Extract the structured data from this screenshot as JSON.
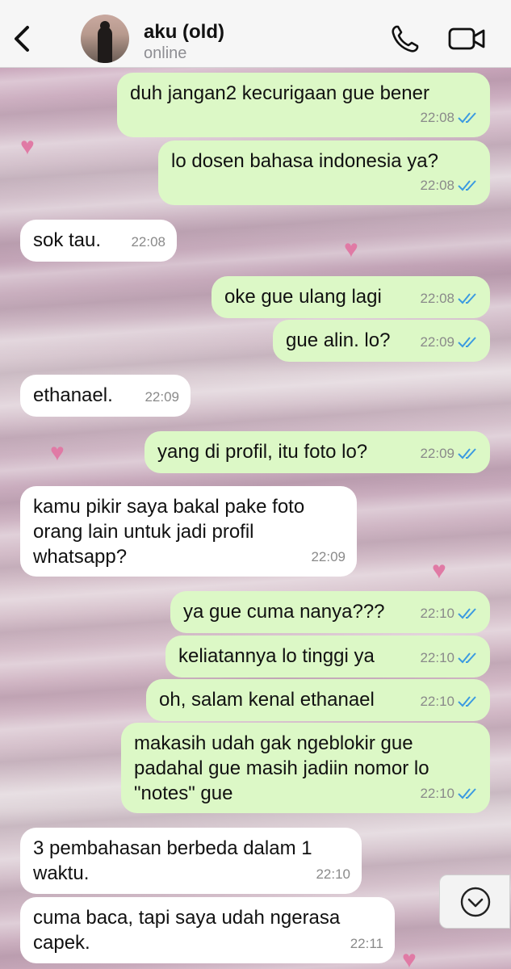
{
  "header": {
    "contact_name": "aku (old)",
    "status": "online"
  },
  "messages": [
    {
      "dir": "out",
      "text": "duh jangan2 kecurigaan gue bener",
      "time": "22:08"
    },
    {
      "dir": "out",
      "text": "lo dosen bahasa indonesia ya?",
      "time": "22:08"
    },
    {
      "dir": "in",
      "text": "sok tau.",
      "time": "22:08"
    },
    {
      "dir": "out",
      "text": "oke gue ulang lagi",
      "time": "22:08"
    },
    {
      "dir": "out",
      "text": "gue alin. lo?",
      "time": "22:09"
    },
    {
      "dir": "in",
      "text": "ethanael.",
      "time": "22:09"
    },
    {
      "dir": "out",
      "text": "yang di profil, itu foto lo?",
      "time": "22:09"
    },
    {
      "dir": "in",
      "text": "kamu pikir saya bakal pake foto\norang lain untuk jadi profil\nwhatsapp?",
      "time": "22:09"
    },
    {
      "dir": "out",
      "text": "ya gue cuma nanya???",
      "time": "22:10"
    },
    {
      "dir": "out",
      "text": "keliatannya lo tinggi ya",
      "time": "22:10"
    },
    {
      "dir": "out",
      "text": "oh, salam kenal ethanael",
      "time": "22:10"
    },
    {
      "dir": "out",
      "text": "makasih udah gak ngeblokir gue\npadahal gue masih jadiin nomor lo\n\"notes\" gue",
      "time": "22:10"
    },
    {
      "dir": "in",
      "text": "3 pembahasan berbeda dalam 1\nwaktu.",
      "time": "22:10"
    },
    {
      "dir": "in",
      "text": "cuma baca, tapi saya udah ngerasa\ncapek.",
      "time": "22:11"
    }
  ],
  "colors": {
    "outgoing_bubble": "#dcf8c6",
    "incoming_bubble": "#ffffff",
    "read_tick": "#3b9ae1",
    "accent": "#111111"
  },
  "icons": [
    "back-chevron-icon",
    "phone-icon",
    "video-camera-icon",
    "double-check-icon",
    "chevron-down-icon",
    "heart-icon"
  ]
}
